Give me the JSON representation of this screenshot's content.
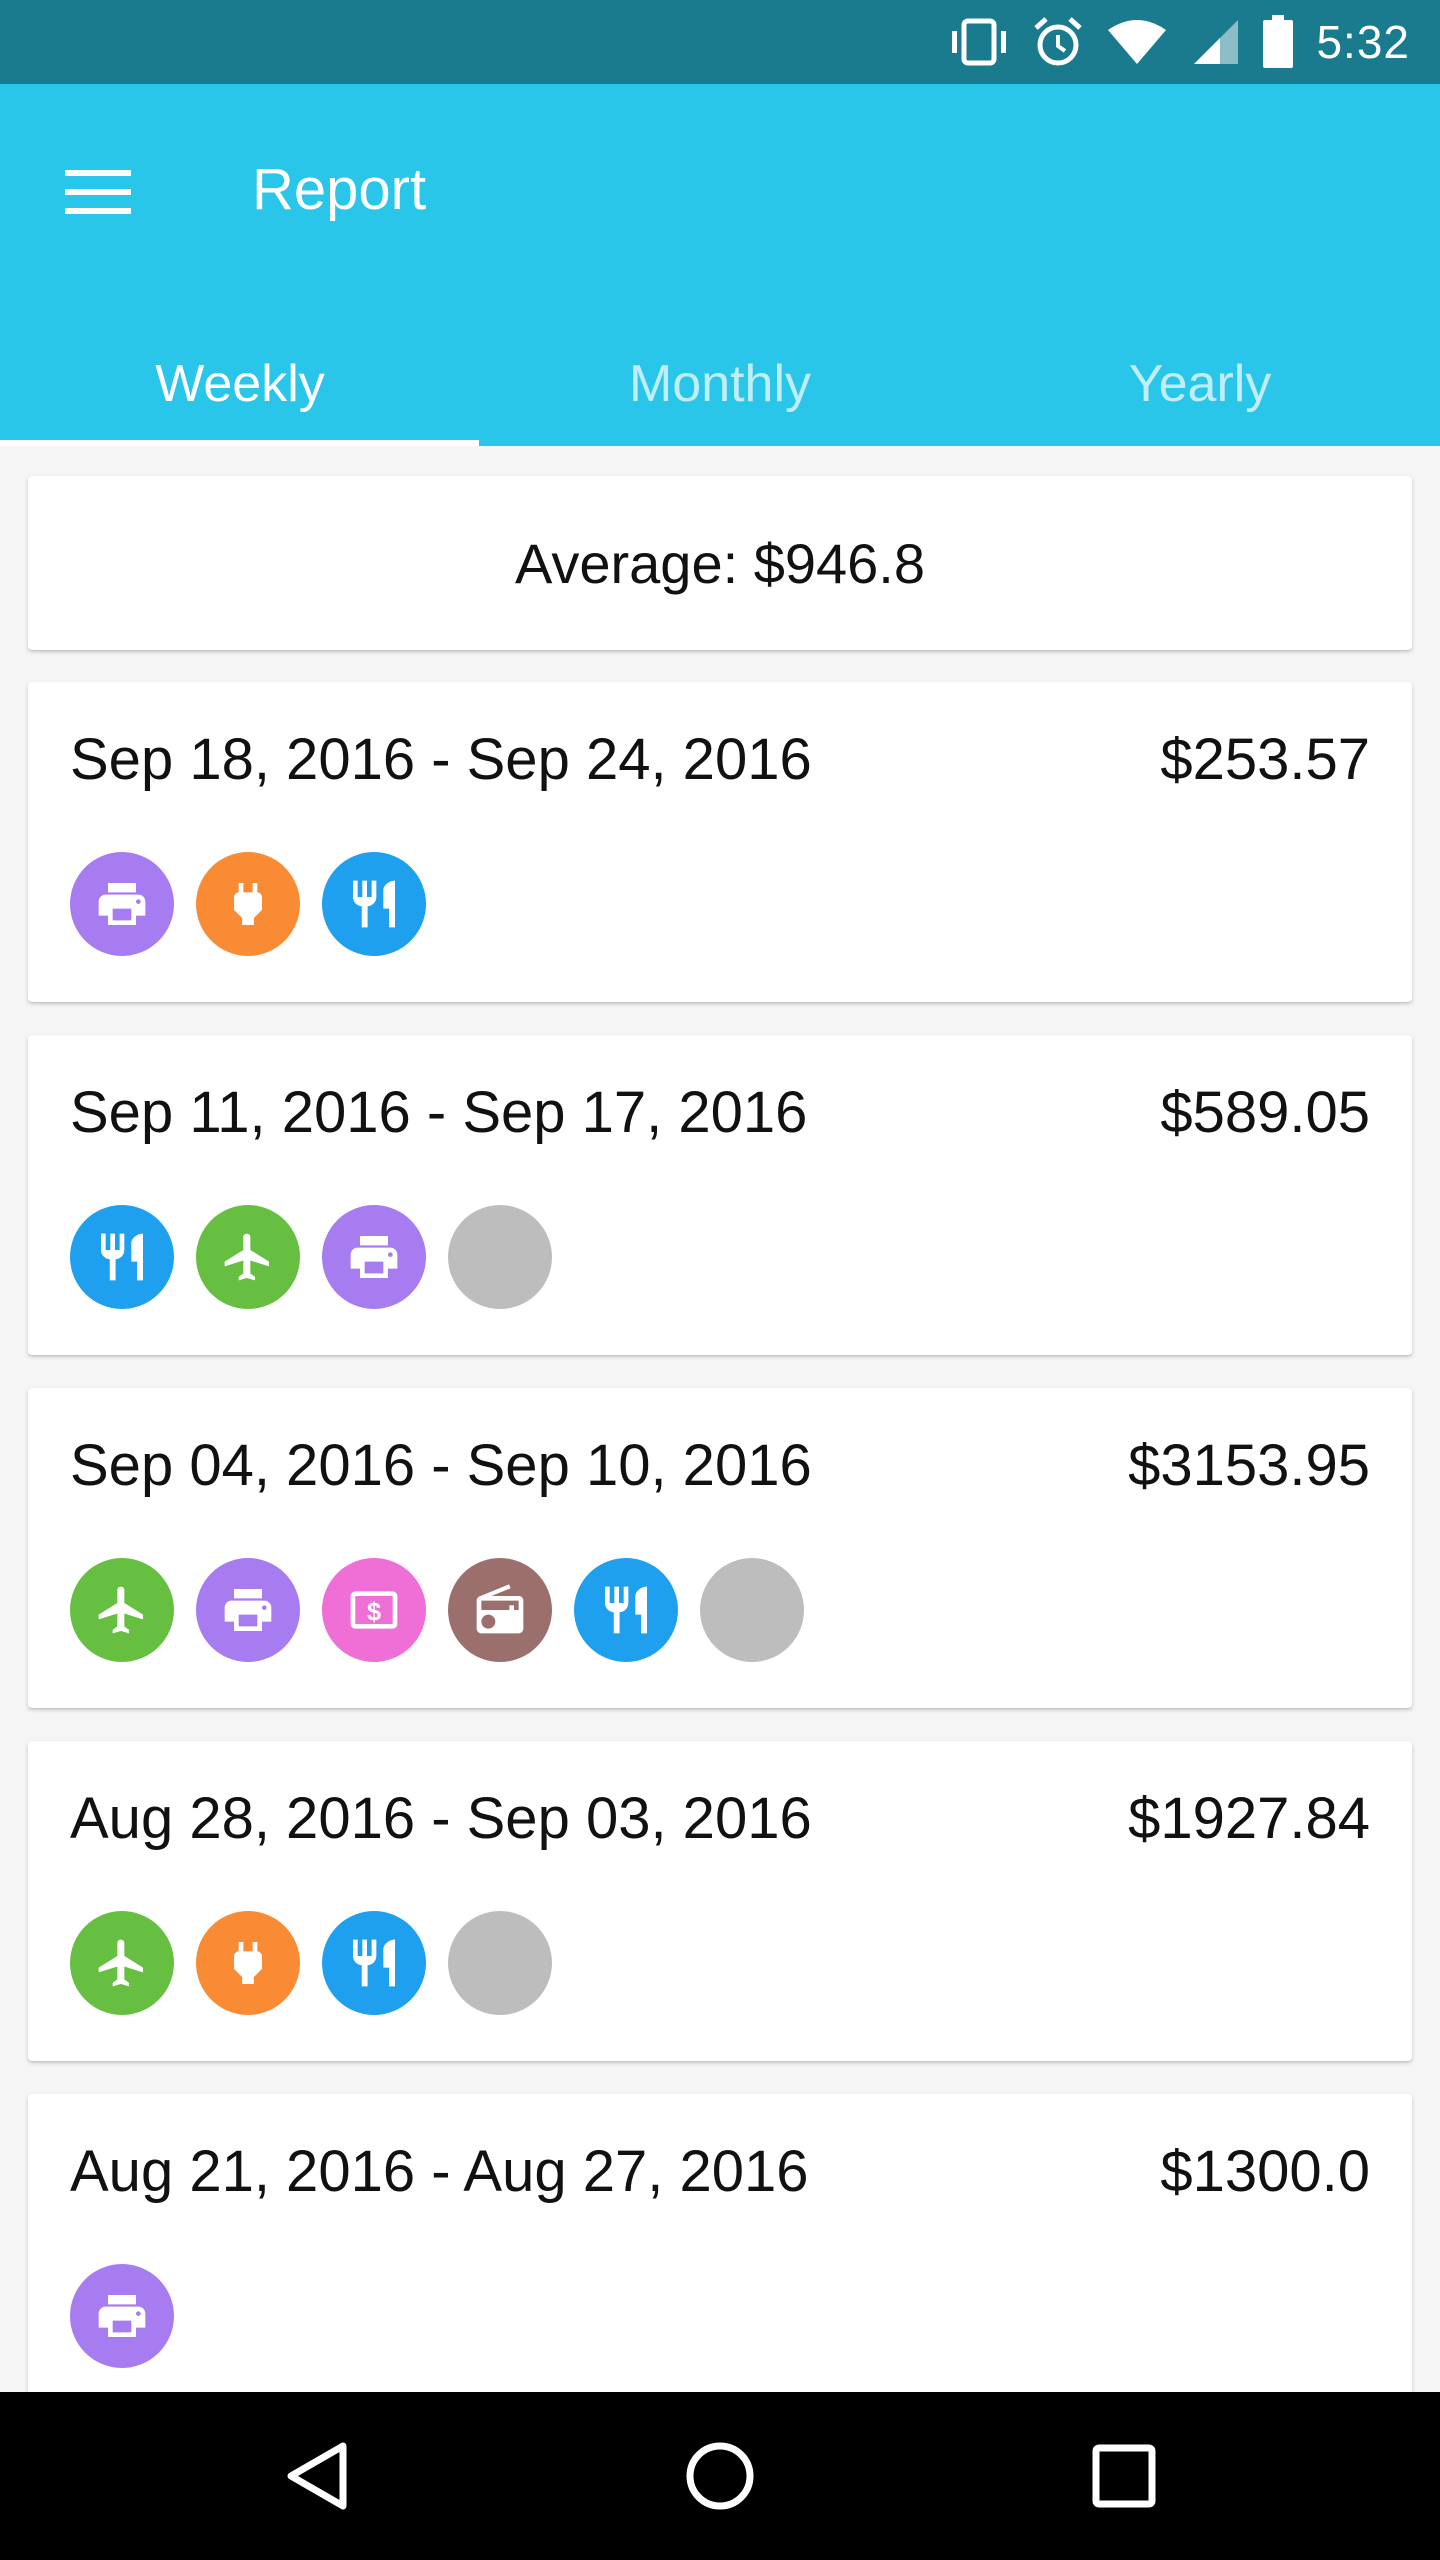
{
  "status_bar": {
    "time": "5:32",
    "icons": [
      "vibrate-icon",
      "alarm-icon",
      "wifi-icon",
      "signal-icon",
      "battery-icon"
    ]
  },
  "app_bar": {
    "title": "Report",
    "menu_icon": "hamburger-menu-icon",
    "color": "#29c6ea"
  },
  "tabs": [
    {
      "label": "Weekly",
      "active": true
    },
    {
      "label": "Monthly",
      "active": false
    },
    {
      "label": "Yearly",
      "active": false
    }
  ],
  "summary": {
    "average_label": "Average: $946.8"
  },
  "category_colors": {
    "printer": "#a77cf0",
    "plug": "#f98b34",
    "food": "#1fa0ee",
    "plane": "#66bf41",
    "cash": "#ef6fd7",
    "radio": "#9b6f6c",
    "other": "#bdbdbd"
  },
  "weeks": [
    {
      "range": "Sep 18, 2016 - Sep 24, 2016",
      "amount": "$253.57",
      "categories": [
        "printer",
        "plug",
        "food"
      ]
    },
    {
      "range": "Sep 11, 2016 - Sep 17, 2016",
      "amount": "$589.05",
      "categories": [
        "food",
        "plane",
        "printer",
        "other"
      ]
    },
    {
      "range": "Sep 04, 2016 - Sep 10, 2016",
      "amount": "$3153.95",
      "categories": [
        "plane",
        "printer",
        "cash",
        "radio",
        "food",
        "other"
      ]
    },
    {
      "range": "Aug 28, 2016 - Sep 03, 2016",
      "amount": "$1927.84",
      "categories": [
        "plane",
        "plug",
        "food",
        "other"
      ]
    },
    {
      "range": "Aug 21, 2016 - Aug 27, 2016",
      "amount": "$1300.0",
      "categories": [
        "printer"
      ]
    }
  ],
  "nav_bar": {
    "buttons": [
      "back-icon",
      "home-icon",
      "recents-icon"
    ]
  }
}
